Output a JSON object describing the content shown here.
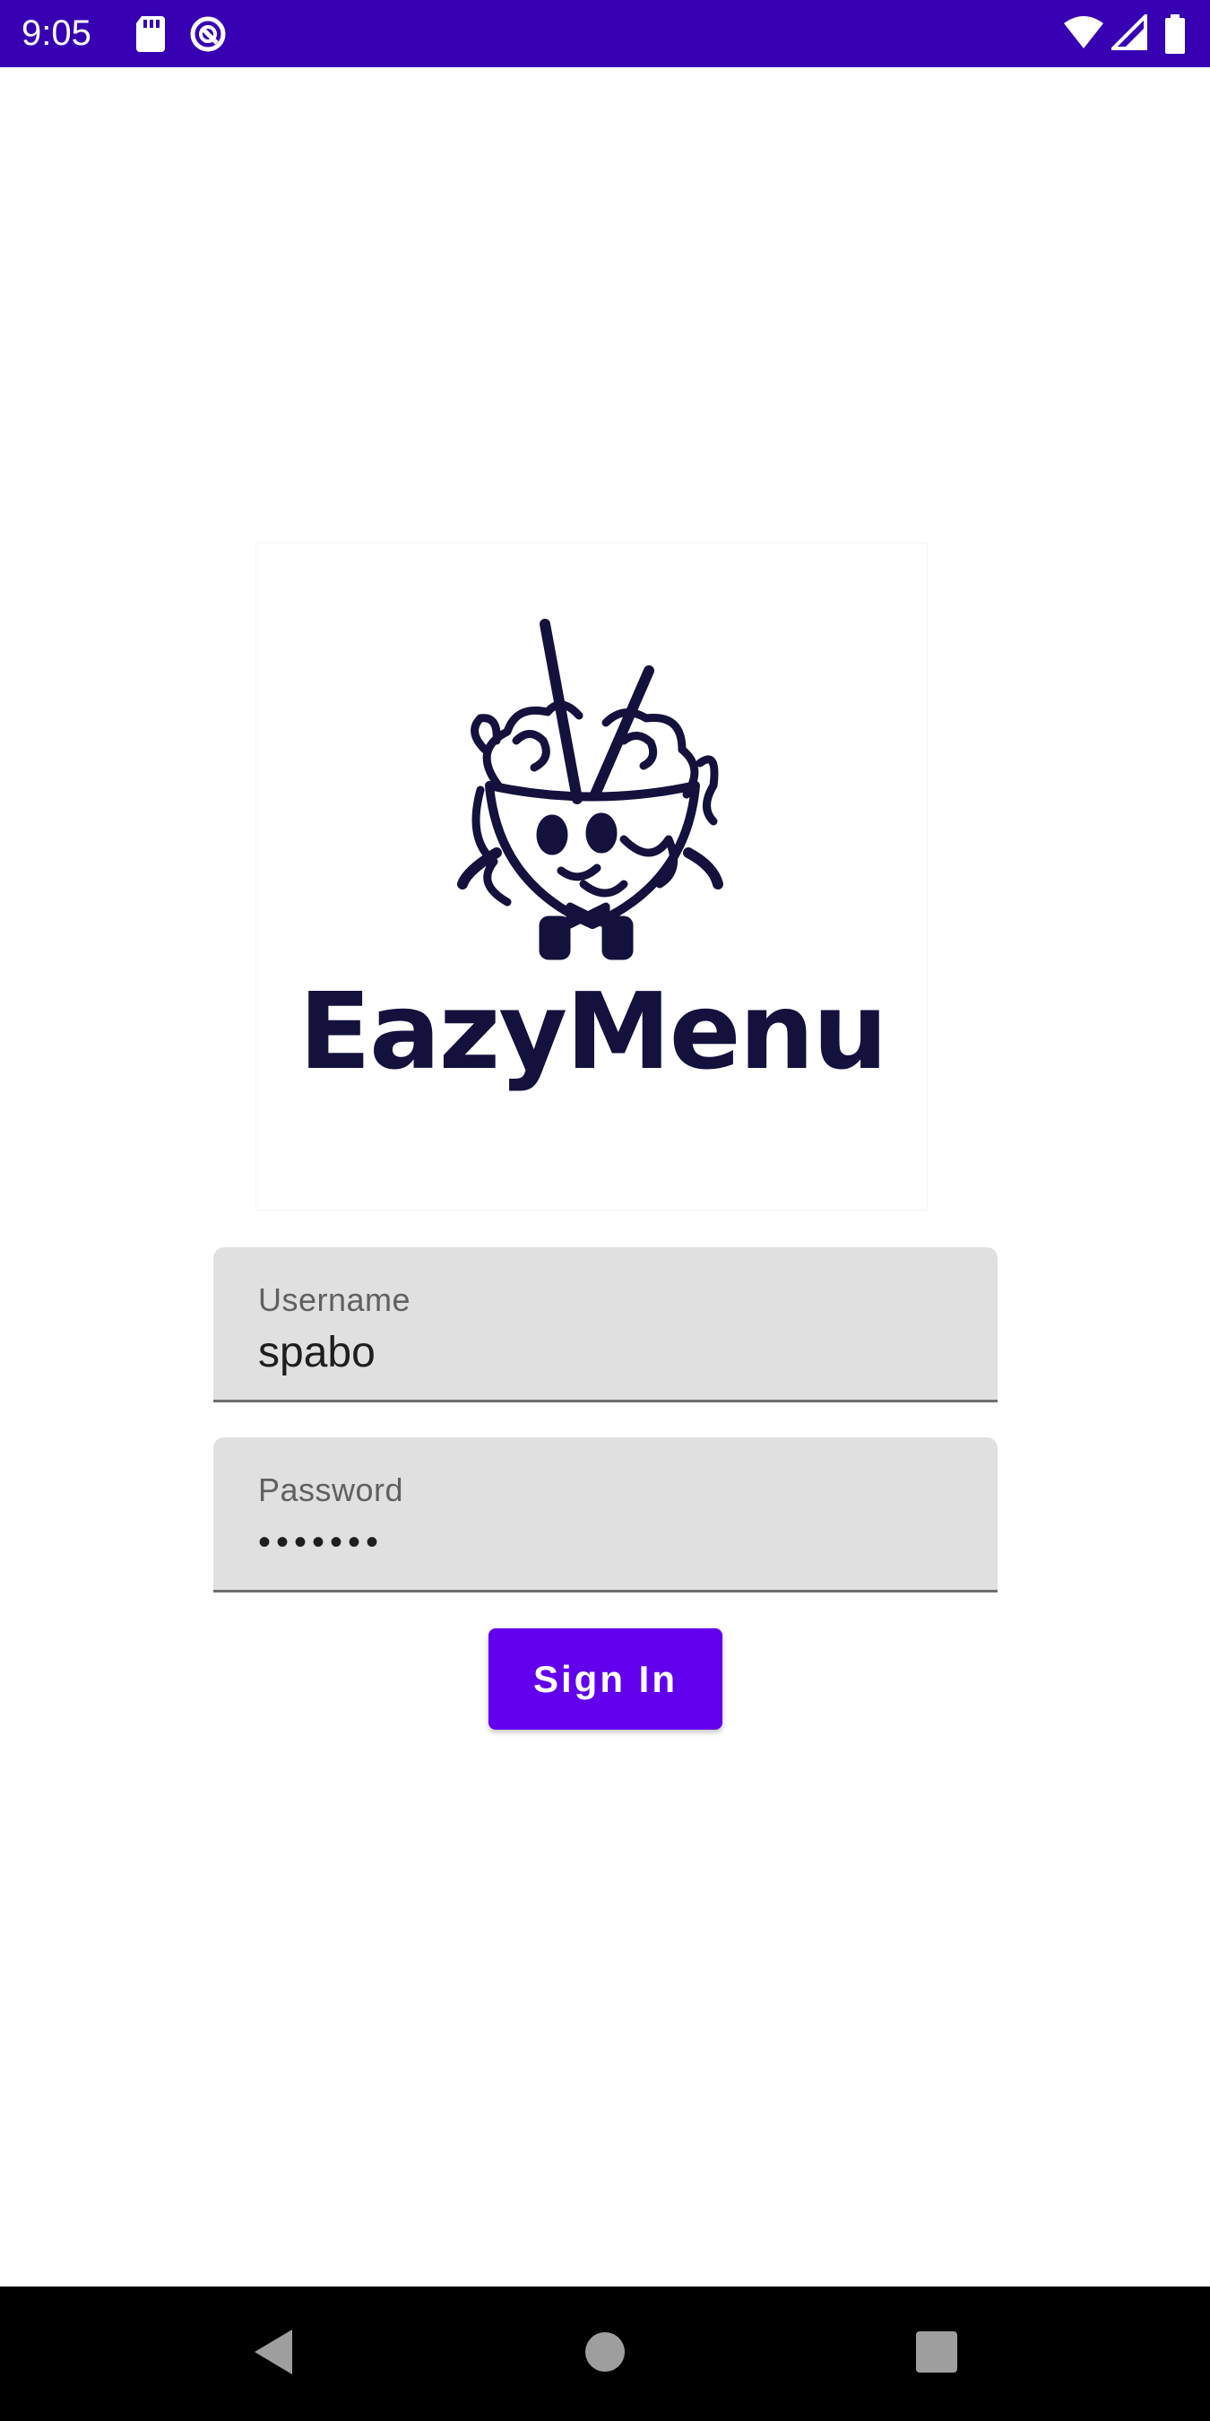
{
  "status_bar": {
    "time": "9:05",
    "icons": [
      "sd-card-icon",
      "sync-icon",
      "wifi-icon",
      "signal-icon",
      "battery-icon"
    ],
    "background": "#3700b3"
  },
  "logo": {
    "wordmark": "EazyMenu",
    "icon": "noodle-bowl-mascot-icon",
    "color": "#14113d"
  },
  "form": {
    "username": {
      "label": "Username",
      "value": "spabo"
    },
    "password": {
      "label": "Password",
      "value": "•••••••"
    },
    "signin_label": "Sign In",
    "accent": "#6200ee",
    "field_background": "#e0e0e0"
  },
  "nav_bar": {
    "buttons": [
      "back-icon",
      "home-icon",
      "recents-icon"
    ]
  }
}
